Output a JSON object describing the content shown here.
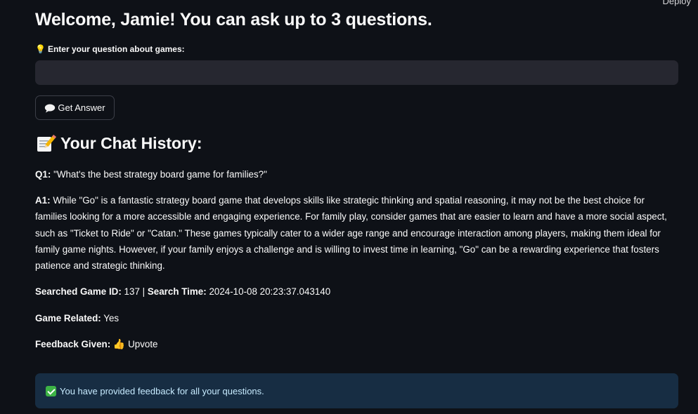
{
  "header": {
    "deploy_label": "Deploy"
  },
  "page": {
    "title": "Welcome, Jamie! You can ask up to 3 questions.",
    "input_label": "Enter your question about games:",
    "input_value": "",
    "button_label": "Get Answer"
  },
  "history": {
    "heading": "Your Chat History:",
    "q_label": "Q1:",
    "question": "\"What's the best strategy board game for families?\"",
    "a_label": "A1:",
    "answer": "While \"Go\" is a fantastic strategy board game that develops skills like strategic thinking and spatial reasoning, it may not be the best choice for families looking for a more accessible and engaging experience. For family play, consider games that are easier to learn and have a more social aspect, such as \"Ticket to Ride\" or \"Catan.\" These games typically cater to a wider age range and encourage interaction among players, making them ideal for family game nights. However, if your family enjoys a challenge and is willing to invest time in learning, \"Go\" can be a rewarding experience that fosters patience and strategic thinking.",
    "game_id_label": "Searched Game ID:",
    "game_id": "137",
    "separator": "|",
    "search_time_label": "Search Time:",
    "search_time": "2024-10-08 20:23:37.043140",
    "game_related_label": "Game Related:",
    "game_related": "Yes",
    "feedback_label": "Feedback Given:",
    "feedback_value": "Upvote"
  },
  "alert": {
    "message": "You have provided feedback for all your questions."
  },
  "icons": {
    "bulb": "lightbulb-icon",
    "bubble": "speech-bubble-icon",
    "memo": "memo-icon",
    "thumb": "thumbs-up-icon",
    "check": "check-icon"
  },
  "colors": {
    "background": "#0e1117",
    "input_bg": "#262730",
    "alert_bg": "#172d43",
    "alert_text": "#c7ebff",
    "check_green": "#3db346"
  }
}
